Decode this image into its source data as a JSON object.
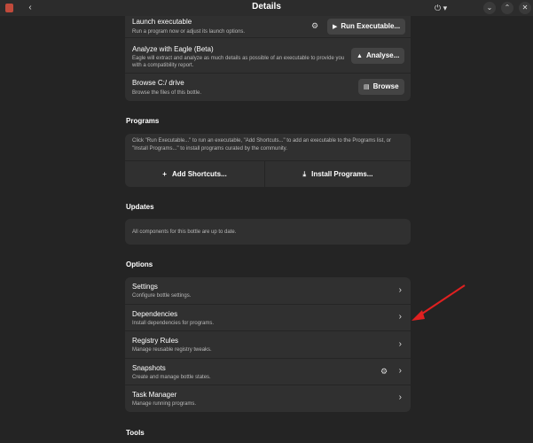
{
  "window": {
    "title": "Details"
  },
  "top_card": {
    "launch": {
      "title": "Launch executable",
      "subtitle": "Run a program now or adjust its launch options.",
      "button": "Run Executable..."
    },
    "eagle": {
      "title": "Analyze with Eagle (Beta)",
      "subtitle": "Eagle will extract and analyze as much details as possible of an executable to provide you with a compatibility report.",
      "button": "Analyse..."
    },
    "browse": {
      "title": "Browse C:/ drive",
      "subtitle": "Browse the files of this bottle.",
      "button": "Browse"
    }
  },
  "programs": {
    "heading": "Programs",
    "description": "Click \"Run Executable...\" to run an executable, \"Add Shortcuts...\" to add an executable to the Programs list, or \"Install Programs...\" to install programs curated by the community.",
    "add_label": "Add Shortcuts...",
    "install_label": "Install Programs..."
  },
  "updates": {
    "heading": "Updates",
    "text": "All components for this bottle are up to date."
  },
  "options": {
    "heading": "Options",
    "items": [
      {
        "title": "Settings",
        "subtitle": "Configure bottle settings."
      },
      {
        "title": "Dependencies",
        "subtitle": "Install dependencies for programs."
      },
      {
        "title": "Registry Rules",
        "subtitle": "Manage reusable registry tweaks."
      },
      {
        "title": "Snapshots",
        "subtitle": "Create and manage bottle states."
      },
      {
        "title": "Task Manager",
        "subtitle": "Manage running programs."
      }
    ]
  },
  "tools": {
    "heading": "Tools"
  },
  "colors": {
    "annotation_arrow": "#e02020",
    "background": "#242424",
    "card": "#303030"
  }
}
